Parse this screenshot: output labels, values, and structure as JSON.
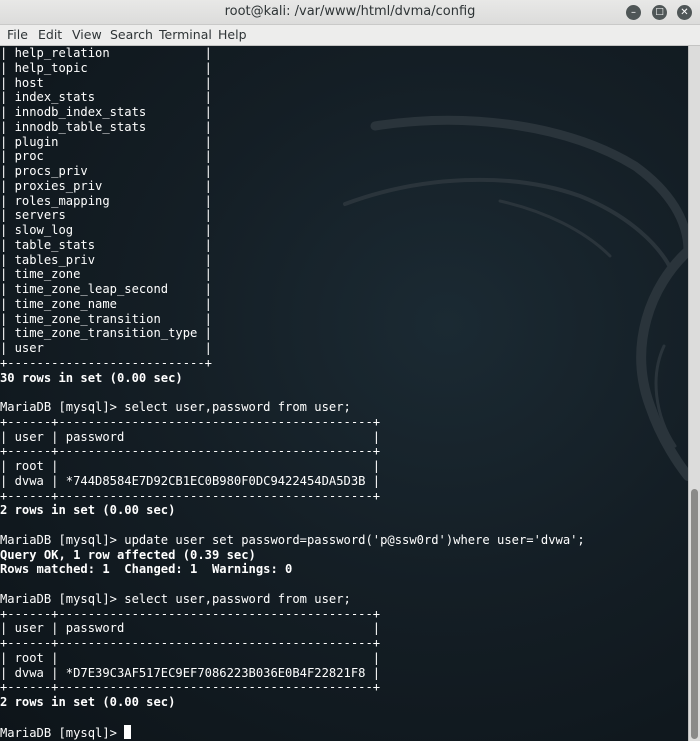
{
  "window": {
    "title": "root@kali: /var/www/html/dvma/config",
    "minimize_glyph": "–",
    "maximize_glyph": "□",
    "close_glyph": "✕"
  },
  "menubar": {
    "items": [
      {
        "label": "File"
      },
      {
        "label": "Edit"
      },
      {
        "label": "View"
      },
      {
        "label": "Search"
      },
      {
        "label": "Terminal"
      },
      {
        "label": "Help"
      }
    ]
  },
  "terminal": {
    "lines": [
      {
        "text": "| help_relation             |",
        "bold": false
      },
      {
        "text": "| help_topic                |",
        "bold": false
      },
      {
        "text": "| host                      |",
        "bold": false
      },
      {
        "text": "| index_stats               |",
        "bold": false
      },
      {
        "text": "| innodb_index_stats        |",
        "bold": false
      },
      {
        "text": "| innodb_table_stats        |",
        "bold": false
      },
      {
        "text": "| plugin                    |",
        "bold": false
      },
      {
        "text": "| proc                      |",
        "bold": false
      },
      {
        "text": "| procs_priv                |",
        "bold": false
      },
      {
        "text": "| proxies_priv              |",
        "bold": false
      },
      {
        "text": "| roles_mapping             |",
        "bold": false
      },
      {
        "text": "| servers                   |",
        "bold": false
      },
      {
        "text": "| slow_log                  |",
        "bold": false
      },
      {
        "text": "| table_stats               |",
        "bold": false
      },
      {
        "text": "| tables_priv               |",
        "bold": false
      },
      {
        "text": "| time_zone                 |",
        "bold": false
      },
      {
        "text": "| time_zone_leap_second     |",
        "bold": false
      },
      {
        "text": "| time_zone_name            |",
        "bold": false
      },
      {
        "text": "| time_zone_transition      |",
        "bold": false
      },
      {
        "text": "| time_zone_transition_type |",
        "bold": false
      },
      {
        "text": "| user                      |",
        "bold": false
      },
      {
        "text": "+---------------------------+",
        "bold": false
      },
      {
        "text": "30 rows in set (0.00 sec)",
        "bold": true
      },
      {
        "text": "",
        "bold": false
      },
      {
        "text": "MariaDB [mysql]> select user,password from user;",
        "bold": false
      },
      {
        "text": "+------+-------------------------------------------+",
        "bold": false
      },
      {
        "text": "| user | password                                  |",
        "bold": false
      },
      {
        "text": "+------+-------------------------------------------+",
        "bold": false
      },
      {
        "text": "| root |                                           |",
        "bold": false
      },
      {
        "text": "| dvwa | *744D8584E7D92CB1EC0B980F0DC9422454DA5D3B |",
        "bold": false
      },
      {
        "text": "+------+-------------------------------------------+",
        "bold": false
      },
      {
        "text": "2 rows in set (0.00 sec)",
        "bold": true
      },
      {
        "text": "",
        "bold": false
      },
      {
        "text": "MariaDB [mysql]> update user set password=password('p@ssw0rd')where user='dvwa';",
        "bold": false
      },
      {
        "text": "Query OK, 1 row affected (0.39 sec)",
        "bold": true
      },
      {
        "text": "Rows matched: 1  Changed: 1  Warnings: 0",
        "bold": true
      },
      {
        "text": "",
        "bold": false
      },
      {
        "text": "MariaDB [mysql]> select user,password from user;",
        "bold": false
      },
      {
        "text": "+------+-------------------------------------------+",
        "bold": false
      },
      {
        "text": "| user | password                                  |",
        "bold": false
      },
      {
        "text": "+------+-------------------------------------------+",
        "bold": false
      },
      {
        "text": "| root |                                           |",
        "bold": false
      },
      {
        "text": "| dvwa | *D7E39C3AF517EC9EF7086223B036E0B4F22821F8 |",
        "bold": false
      },
      {
        "text": "+------+-------------------------------------------+",
        "bold": false
      },
      {
        "text": "2 rows in set (0.00 sec)",
        "bold": true
      },
      {
        "text": "",
        "bold": false
      }
    ],
    "prompt": "MariaDB [mysql]> "
  },
  "colors": {
    "terminal_bg": "#141e25",
    "terminal_fg": "#ffffff",
    "dragon": "#2a343b"
  }
}
